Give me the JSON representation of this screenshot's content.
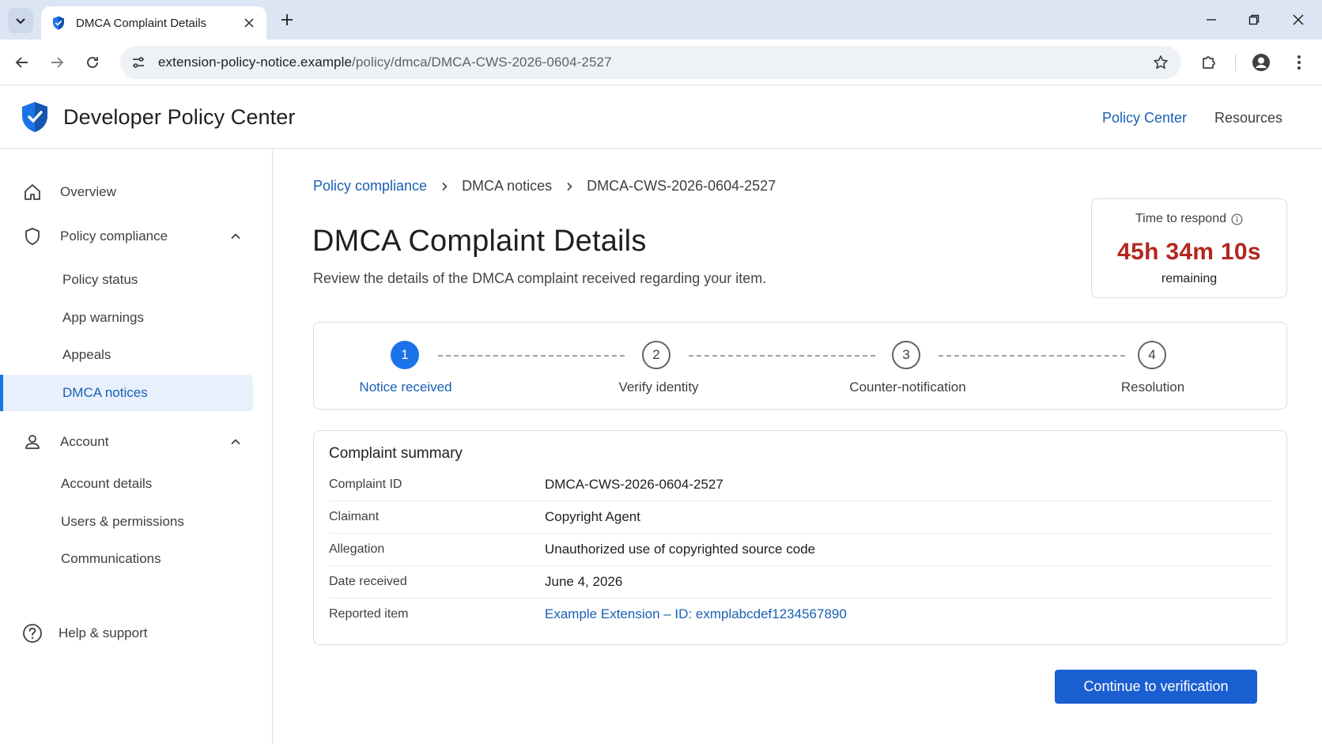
{
  "browser": {
    "tab_title": "DMCA Complaint Details",
    "url_host": "extension-policy-notice.example",
    "url_path": "/policy/dmca/DMCA-CWS-2026-0604-2527"
  },
  "app": {
    "title": "Developer Policy Center",
    "nav": [
      "Policy Center",
      "Resources"
    ]
  },
  "sidebar": {
    "overview": "Overview",
    "policy_compliance": {
      "label": "Policy compliance",
      "items": [
        "Policy status",
        "App warnings",
        "Appeals",
        "DMCA notices"
      ]
    },
    "account": {
      "label": "Account",
      "items": [
        "Account details",
        "Users & permissions",
        "Communications"
      ]
    },
    "help": "Help & support"
  },
  "breadcrumb": [
    "Policy compliance",
    "DMCA notices",
    "DMCA-CWS-2026-0604-2527"
  ],
  "page": {
    "title": "DMCA Complaint Details",
    "subtitle": "Review the details of the DMCA complaint received regarding your item."
  },
  "timer": {
    "label": "Time to respond",
    "value": "45h 34m 10s",
    "suffix": "remaining"
  },
  "steps": [
    {
      "num": "1",
      "label": "Notice received"
    },
    {
      "num": "2",
      "label": "Verify identity"
    },
    {
      "num": "3",
      "label": "Counter-notification"
    },
    {
      "num": "4",
      "label": "Resolution"
    }
  ],
  "summary": {
    "title": "Complaint summary",
    "rows": [
      {
        "key": "Complaint ID",
        "value": "DMCA-CWS-2026-0604-2527"
      },
      {
        "key": "Claimant",
        "value": "Copyright Agent"
      },
      {
        "key": "Allegation",
        "value": "Unauthorized use of copyrighted source code"
      },
      {
        "key": "Date received",
        "value": "June 4, 2026"
      },
      {
        "key": "Reported item",
        "value": "Example Extension – ID: exmplabcdef1234567890"
      }
    ]
  },
  "cta": "Continue to verification",
  "colors": {
    "accent": "#1a73e8",
    "link": "#1a5fb4",
    "timer": "#b3261e",
    "active_nav_bg": "#e8f0fe"
  }
}
